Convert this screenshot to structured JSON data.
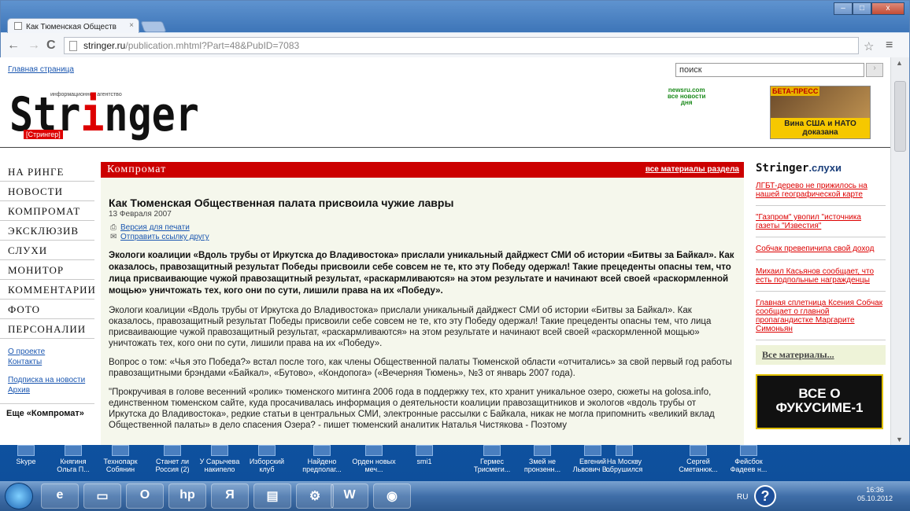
{
  "browser": {
    "tab_title": "Как Тюменская Обществ",
    "tab_close": "×",
    "url_domain": "stringer.ru",
    "url_path": "/publication.mhtml?Part=48&PubID=7083",
    "back": "←",
    "forward": "→",
    "reload": "C",
    "star": "☆",
    "menu": "≡",
    "win_min": "–",
    "win_max": "□",
    "win_close": "x"
  },
  "header": {
    "home_link": "Главная страница",
    "search_value": "поиск",
    "search_btn": "›",
    "logo_tagline": "информационное агентство",
    "logo_pre": "Str",
    "logo_i": "i",
    "logo_post": "nger",
    "logo_sub": "[Стрингер]",
    "newsru": "newsru.com\nвсе новости\nдня",
    "ad_label": "БЕТА-ПРЕСС",
    "ad_text": "Вина США и НАТО доказана"
  },
  "leftnav": {
    "items": [
      "НА РИНГЕ",
      "НОВОСТИ",
      "КОМПРОМАТ",
      "ЭКСКЛЮЗИВ",
      "СЛУХИ",
      "МОНИТОР",
      "КОММЕНТАРИИ",
      "ФОТО",
      "ПЕРСОНАЛИИ"
    ],
    "about": "О проекте",
    "contacts": "Контакты",
    "subscribe": "Подписка на новости",
    "archive": "Архив",
    "more": "Еще «Компромат»"
  },
  "article": {
    "section": "Компромат",
    "all_section": "все материалы раздела",
    "title": "Как Тюменская Общественная палата присвоила чужие лавры",
    "date": "13 Февраля 2007",
    "print": "Версия для печати",
    "send": "Отправить ссылку другу",
    "lead": "Экологи коалиции «Вдоль трубы от Иркутска до Владивостока» прислали уникальный дайджест СМИ об истории «Битвы за Байкал». Как оказалось, правозащитный результат Победы присвоили себе совсем не те, кто эту Победу одержал! Такие прецеденты опасны тем, что лица присваивающие чужой правозащитный результат, «раскармливаются» на этом результате и начинают всей своей «раскормленной мощью» уничтожать тех, кого они по сути, лишили права на их «Победу».",
    "p1": "Экологи коалиции «Вдоль трубы от Иркутска до Владивостока» прислали уникальный дайджест СМИ об истории «Битвы за Байкал». Как оказалось, правозащитный результат Победы присвоили себе совсем не те, кто эту Победу одержал! Такие прецеденты опасны тем, что лица присваивающие чужой правозащитный результат, «раскармливаются» на этом результате и начинают всей своей «раскормленной мощью» уничтожать тех, кого они по сути, лишили права на их «Победу».",
    "p2": "Вопрос о том: «Чья это Победа?» встал после того, как члены Общественной палаты Тюменской области «отчитались» за свой первый год работы правозащитными брэндами «Байкал», «Бутово», «Кондопога» («Вечерняя Тюмень», №3 от январь 2007 года).",
    "p3": "\"Прокручивая в голове весенний «ролик» тюменского митинга 2006 года в поддержку тех, кто хранит уникальное озеро, сюжеты на golosa.info, единственном тюменском сайте, куда просачивалась информация о деятельности коалиции правозащитников и экологов «вдоль трубы от Иркутска до Владивостока», редкие статьи в центральных СМИ, электронные рассылки с Байкала, никак не могла припомнить «великий вклад Общественной палаты» в дело спасения Озера? - пишет тюменский аналитик Наталья Чистякова - Поэтому"
  },
  "right": {
    "logo": "Stringer",
    "logo_suffix": ".слухи",
    "items": [
      "ЛГБТ-дерево не прижилось на нашей географической карте",
      "\"Газпром\" увопил \"источника газеты \"Известия\"",
      "Собчак превепичипа свой доход",
      "Михаил Касьянов сообщает, что есть подпольные награжденцы",
      "Главная сплетница Ксения Собчак сообщает о главной пропагандистке Маргарите Симоньян"
    ],
    "all": "Все материалы...",
    "ad_text": "ВСЕ О ФУКУСИМЕ-1"
  },
  "desktop_icons": [
    "Skype",
    "Княгиня Ольга П...",
    "Технопарк Собянин",
    "Станет ли Россия (2)",
    "У Сарычева накипело",
    "Изборский клуб",
    "Найдено предполаг...",
    "Орден новых меч...",
    "smi1",
    "Гермес Трисмеги...",
    "Змей не пронзенн...",
    "Евгений Львович В...",
    "На Москву обрушился",
    "Сергей Сметанюк...",
    "Фейсбок Фадеев н..."
  ],
  "taskbar": {
    "lang": "RU",
    "help": "?",
    "time": "16:36",
    "date": "05.10.2012",
    "apps": [
      "e",
      "▭",
      "O",
      "hp",
      "Я",
      "▤",
      "⚙",
      "W",
      "◉"
    ]
  }
}
